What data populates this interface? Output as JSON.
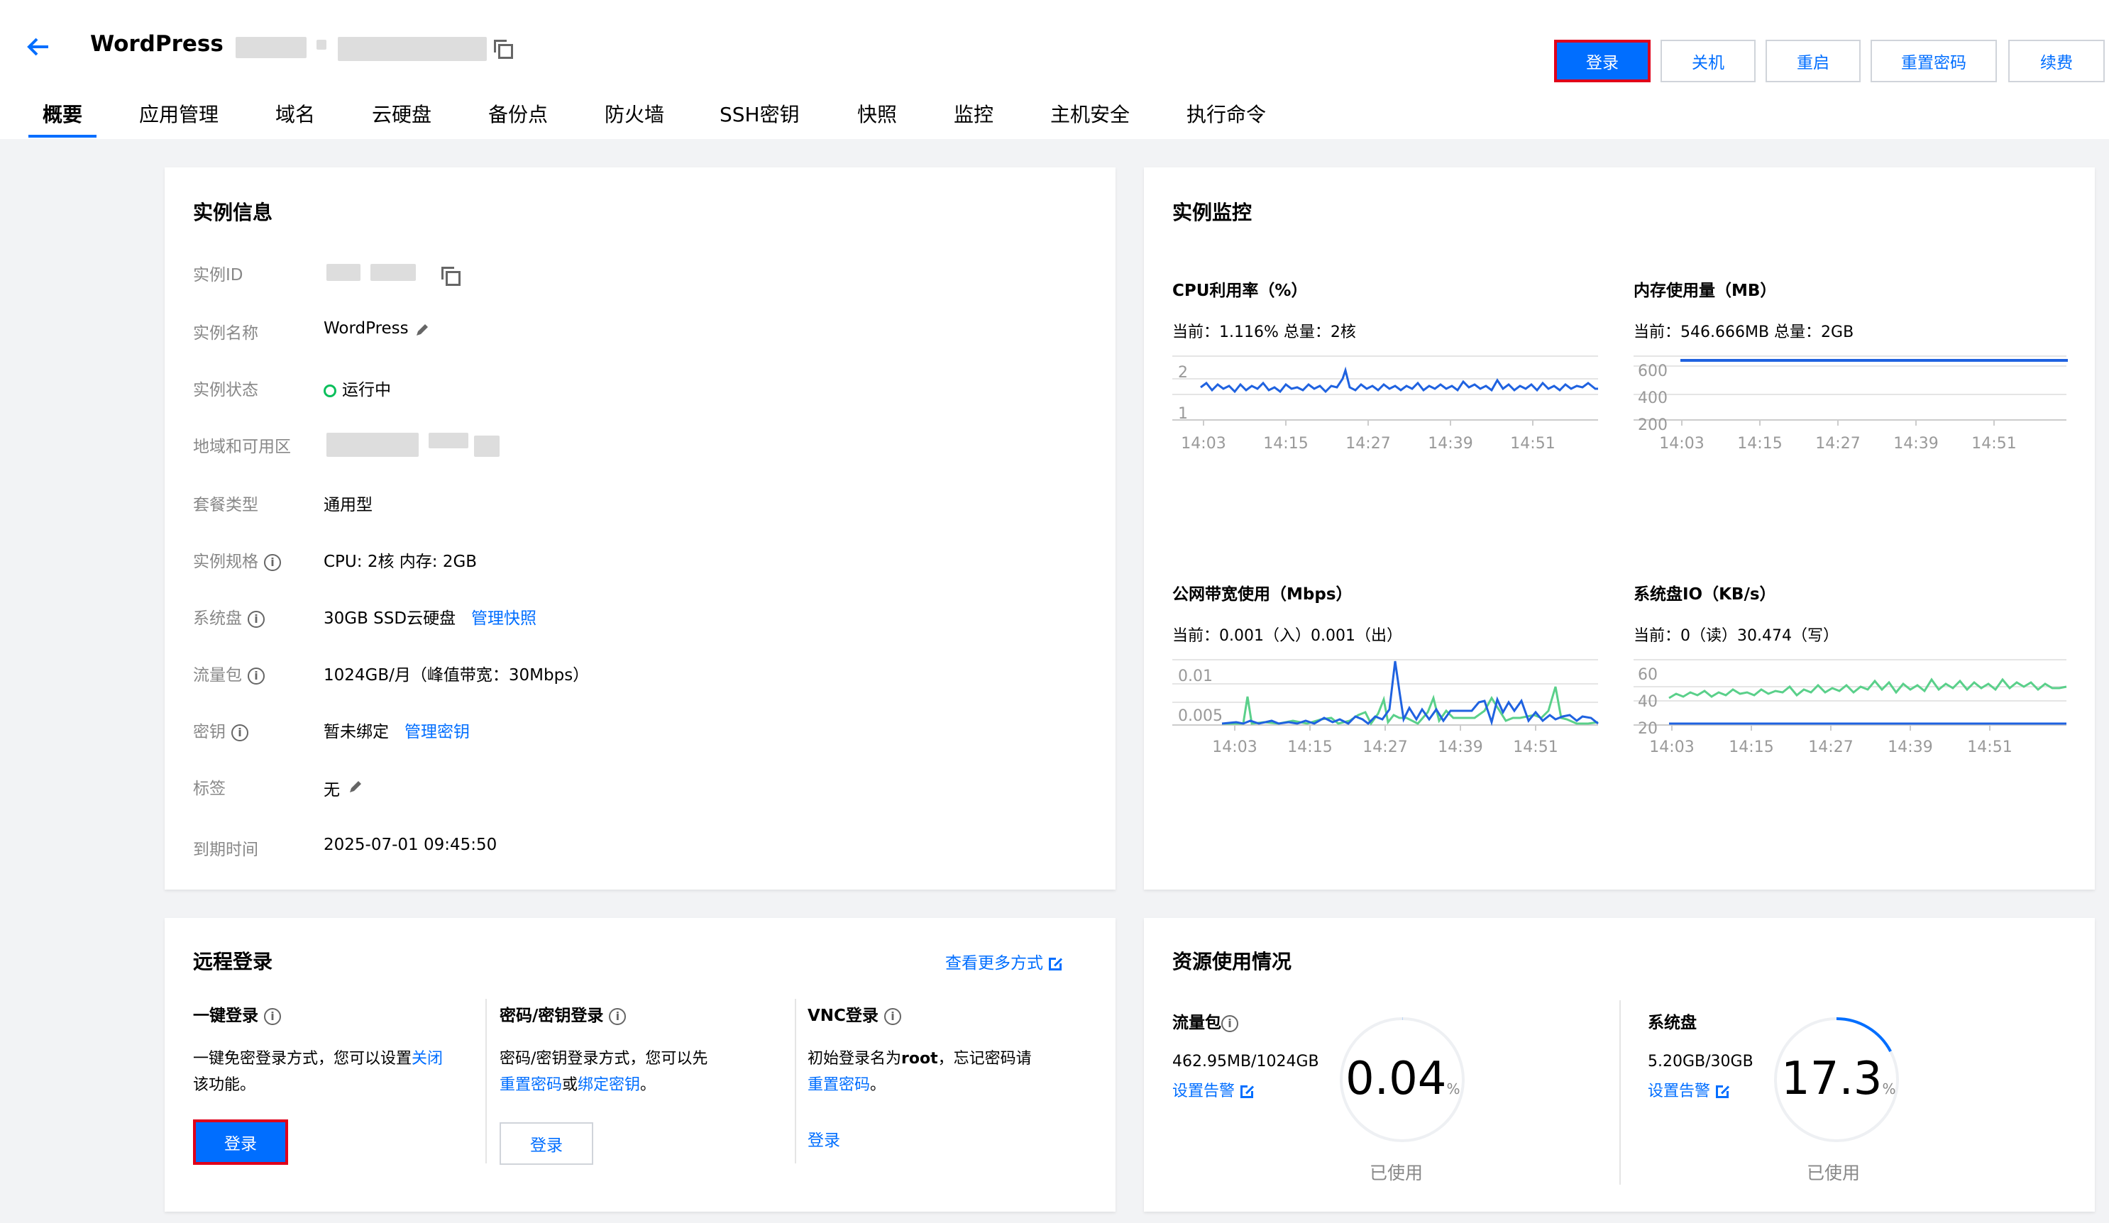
{
  "header": {
    "title": "WordPress",
    "buttons": {
      "login": "登录",
      "shutdown": "关机",
      "restart": "重启",
      "reset_password": "重置密码",
      "renew": "续费"
    }
  },
  "tabs": [
    "概要",
    "应用管理",
    "域名",
    "云硬盘",
    "备份点",
    "防火墙",
    "SSH密钥",
    "快照",
    "监控",
    "主机安全",
    "执行命令"
  ],
  "instance_info": {
    "title": "实例信息",
    "rows": {
      "id_label": "实例ID",
      "name_label": "实例名称",
      "name_value": "WordPress",
      "status_label": "实例状态",
      "status_value": "运行中",
      "region_label": "地域和可用区",
      "package_label": "套餐类型",
      "package_value": "通用型",
      "spec_label": "实例规格",
      "spec_value": "CPU: 2核 内存: 2GB",
      "disk_label": "系统盘",
      "disk_value": "30GB SSD云硬盘",
      "disk_link": "管理快照",
      "traffic_label": "流量包",
      "traffic_value": "1024GB/月（峰值带宽：30Mbps）",
      "key_label": "密钥",
      "key_value": "暂未绑定",
      "key_link": "管理密钥",
      "tag_label": "标签",
      "tag_value": "无",
      "expire_label": "到期时间",
      "expire_value": "2025-07-01 09:45:50"
    }
  },
  "monitoring": {
    "title": "实例监控",
    "cpu": {
      "title": "CPU利用率（%）",
      "current": "当前：1.116% 总量：2核",
      "yticks": [
        "2",
        "1"
      ],
      "xticks": [
        "14:03",
        "14:15",
        "14:27",
        "14:39",
        "14:51"
      ]
    },
    "memory": {
      "title": "内存使用量（MB）",
      "current": "当前：546.666MB 总量：2GB",
      "yticks": [
        "600",
        "400",
        "200"
      ],
      "xticks": [
        "14:03",
        "14:15",
        "14:27",
        "14:39",
        "14:51"
      ]
    },
    "bandwidth": {
      "title": "公网带宽使用（Mbps）",
      "current": "当前：0.001（入）0.001（出）",
      "yticks": [
        "0.01",
        "0.005"
      ],
      "xticks": [
        "14:03",
        "14:15",
        "14:27",
        "14:39",
        "14:51"
      ]
    },
    "diskio": {
      "title": "系统盘IO（KB/s）",
      "current": "当前：0（读）30.474（写）",
      "yticks": [
        "60",
        "40",
        "20"
      ],
      "xticks": [
        "14:03",
        "14:15",
        "14:27",
        "14:39",
        "14:51"
      ]
    }
  },
  "remote_login": {
    "title": "远程登录",
    "more_link": "查看更多方式",
    "one_click": {
      "title": "一键登录",
      "text1": "一键免密登录方式，您可以设置",
      "link": "关闭",
      "text2": "该功能。",
      "button": "登录"
    },
    "password": {
      "title": "密码/密钥登录",
      "text1": "密码/密钥登录方式，您可以先",
      "link1": "重置密码",
      "or": "或",
      "link2": "绑定密钥",
      "end": "。",
      "button": "登录"
    },
    "vnc": {
      "title": "VNC登录",
      "text1": "初始登录名为",
      "root": "root",
      "text2": "，忘记密码请",
      "link": "重置密码",
      "end": "。",
      "button": "登录"
    }
  },
  "resource_usage": {
    "title": "资源使用情况",
    "traffic": {
      "title": "流量包",
      "value": "462.95MB/1024GB",
      "alert": "设置告警",
      "percent": "0.04",
      "unit": "%",
      "used": "已使用",
      "fraction": 0.0004
    },
    "disk": {
      "title": "系统盘",
      "value": "5.20GB/30GB",
      "alert": "设置告警",
      "percent": "17.3",
      "unit": "%",
      "used": "已使用",
      "fraction": 0.173
    }
  },
  "colors": {
    "accent": "#006eff",
    "chart_blue": "#1f62e0",
    "chart_green": "#5ad08a",
    "status_green": "#0abf5b",
    "highlight_red": "#e0001a"
  }
}
